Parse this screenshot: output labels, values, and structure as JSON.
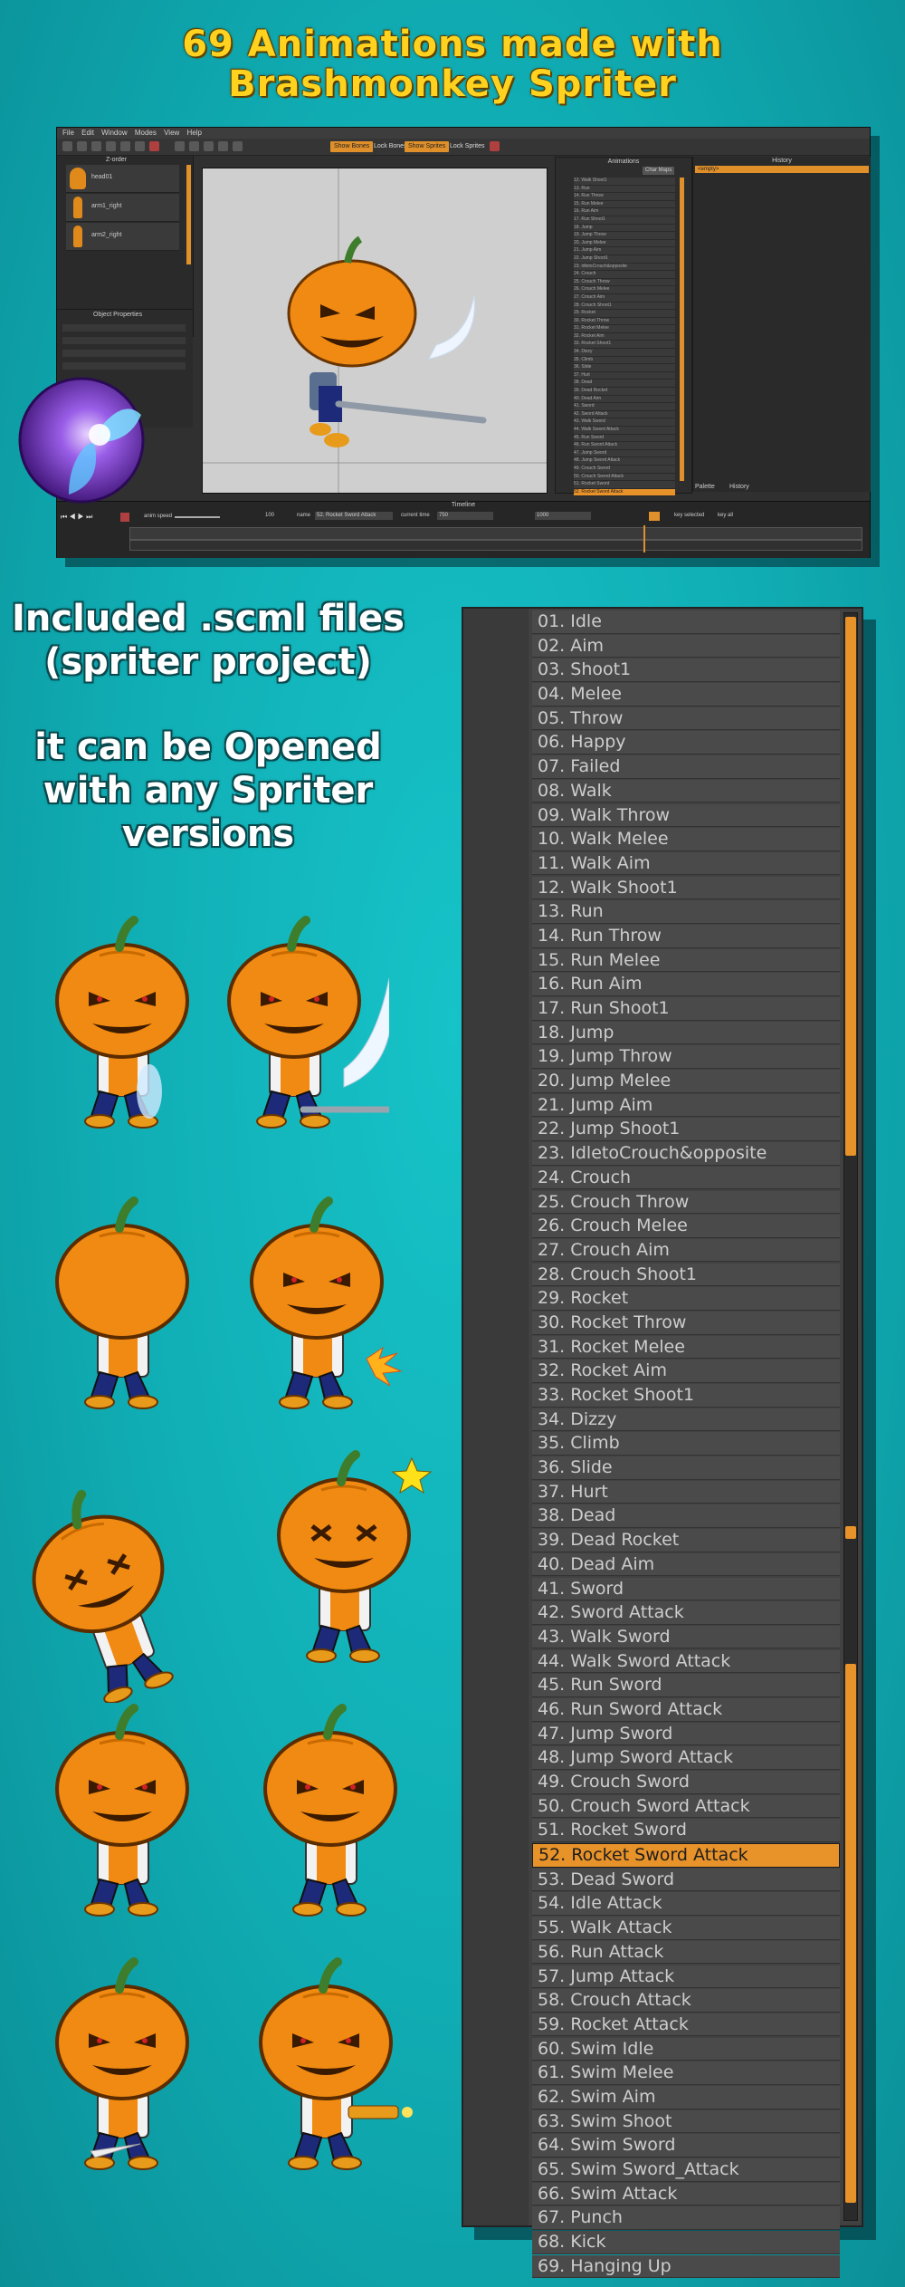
{
  "headline": {
    "line1": "69 Animations made with",
    "line2": "Brashmonkey Spriter"
  },
  "info_text": {
    "line1": "Included .scml files",
    "line2": "(spriter project)",
    "line3": "it can be Opened",
    "line4": "with any Spriter",
    "line5": "versions"
  },
  "editor": {
    "menu": [
      "File",
      "Edit",
      "Window",
      "Modes",
      "View",
      "Help"
    ],
    "toolbar": {
      "show_bones": "Show Bones",
      "lock_bones": "Lock Bones",
      "show_sprites": "Show Sprites",
      "lock_sprites": "Lock Sprites"
    },
    "panels": {
      "hierarchy": "Z-order",
      "object_properties": "Object Properties",
      "animations": "Animations",
      "history": "History",
      "palette": "Palette",
      "history_tab": "History"
    },
    "hierarchy_items": [
      "head01",
      "arm1_right",
      "arm2_right"
    ],
    "history_entry": "<empty>",
    "char_maps": "Char Maps",
    "timeline": {
      "title": "Timeline",
      "anim_speed": "anim speed",
      "speed_value": "100",
      "name_label": "name",
      "name_value": "52. Rocket Sword Attack",
      "current_time_label": "current time",
      "current_time_value": "750",
      "length_value": "1000",
      "key_selected": "key selected",
      "key_all": "key all"
    }
  },
  "animation_list": [
    "01. Idle",
    "02. Aim",
    "03. Shoot1",
    "04. Melee",
    "05. Throw",
    "06. Happy",
    "07. Failed",
    "08. Walk",
    "09. Walk Throw",
    "10. Walk Melee",
    "11. Walk Aim",
    "12. Walk Shoot1",
    "13. Run",
    "14. Run Throw",
    "15. Run Melee",
    "16. Run Aim",
    "17. Run Shoot1",
    "18. Jump",
    "19. Jump Throw",
    "20. Jump Melee",
    "21. Jump Aim",
    "22. Jump Shoot1",
    "23. IdletoCrouch&opposite",
    "24. Crouch",
    "25. Crouch Throw",
    "26. Crouch Melee",
    "27. Crouch Aim",
    "28. Crouch Shoot1",
    "29. Rocket",
    "30. Rocket Throw",
    "31. Rocket Melee",
    "32. Rocket Aim",
    "33. Rocket Shoot1",
    "34. Dizzy",
    "35. Climb",
    "36. Slide",
    "37. Hurt",
    "38. Dead",
    "39. Dead Rocket",
    "40. Dead Aim",
    "41. Sword",
    "42. Sword Attack",
    "43. Walk Sword",
    "44. Walk Sword Attack",
    "45. Run Sword",
    "46. Run Sword Attack",
    "47. Jump Sword",
    "48. Jump Sword Attack",
    "49. Crouch Sword",
    "50. Crouch Sword Attack",
    "51. Rocket Sword",
    "52. Rocket Sword Attack",
    "53. Dead Sword",
    "54. Idle Attack",
    "55. Walk Attack",
    "56. Run Attack",
    "57. Jump Attack",
    "58. Crouch Attack",
    "59. Rocket Attack",
    "60. Swim Idle",
    "61. Swim Melee",
    "62. Swim Aim",
    "63. Swim Shoot",
    "64. Swim Sword",
    "65. Swim Sword_Attack",
    "66. Swim Attack",
    "67. Punch",
    "68. Kick",
    "69. Hanging Up"
  ],
  "selected_animation": "52. Rocket Sword Attack",
  "colors": {
    "accent_orange": "#e8922a",
    "background_teal": "#10acb3",
    "headline_yellow": "#ffd21f",
    "pumpkin_orange": "#f08a12"
  }
}
